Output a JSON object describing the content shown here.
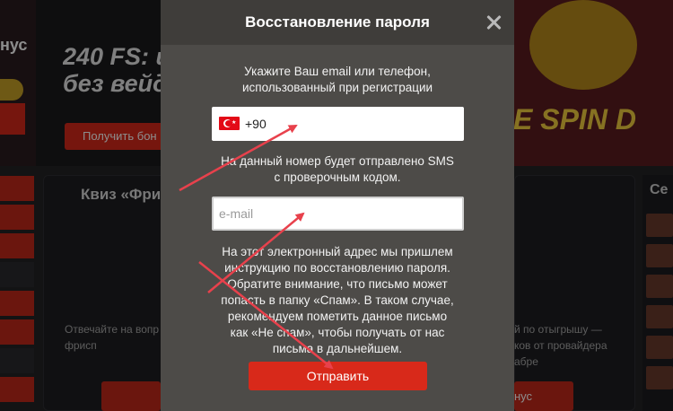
{
  "background": {
    "left_word": "нус",
    "promo_title": "240 FS: и\nбез вейд",
    "promo_button": "Получить бон",
    "game_text": "E SPIN D",
    "card_title": "Квиз «Фри",
    "card_text_left": "Отвечайте на вопр\nфрисп",
    "card_text_right": "й по отыгрышу —\nков от провайдера\nабре",
    "card_button_right": "нус",
    "right_word": "Се"
  },
  "modal": {
    "title": "Восстановление пароля",
    "instruction": "Укажите Ваш email или телефон,\nиспользованный при регистрации",
    "phone": {
      "country": "TR",
      "value": "+90"
    },
    "sms_note": "На данный номер будет отправлено SMS\nс проверочным кодом.",
    "email": {
      "value": "",
      "placeholder": "e-mail"
    },
    "email_note": "На этот электронный адрес мы пришлем\nинструкцию по восстановлению пароля.\nОбратите внимание, что письмо может\nпопасть в папку «Спам». В таком случае,\nрекомендуем пометить данное письмо\nкак «Не спам», чтобы получать от нас\nписьма в дальнейшем.",
    "submit_label": "Отправить"
  },
  "colors": {
    "accent": "#d8291a",
    "annotation": "#e8414c",
    "modal_bg": "#4d4b48",
    "modal_header": "#3f3d3a"
  }
}
